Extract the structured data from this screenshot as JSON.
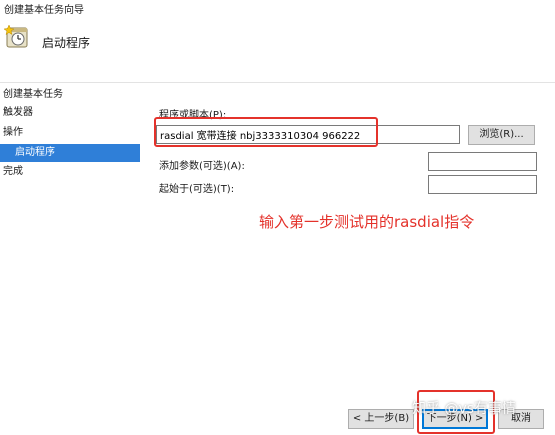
{
  "window": {
    "title": "创建基本任务向导"
  },
  "header": {
    "title": "启动程序",
    "icon": "task-clock-icon"
  },
  "nav": {
    "items": [
      {
        "label": "创建基本任务"
      },
      {
        "label": "触发器"
      },
      {
        "label": "操作"
      },
      {
        "label": "启动程序",
        "selected": true
      },
      {
        "label": "完成"
      }
    ]
  },
  "form": {
    "program_label": "程序或脚本(P):",
    "program_value": "rasdial 宽带连接 nbj3333310304 966222",
    "browse_label": "浏览(R)...",
    "args_label": "添加参数(可选)(A):",
    "args_value": "",
    "start_in_label": "起始于(可选)(T):",
    "start_in_value": ""
  },
  "annotation": {
    "text": "输入第一步测试用的rasdial指令",
    "color": "#e4322b"
  },
  "footer": {
    "back_label": "< 上一步(B)",
    "next_label": "下一步(N) >",
    "cancel_label": "取消"
  },
  "watermark": {
    "text": "知乎 @vs有事情"
  },
  "colors": {
    "accent": "#2f7fd8",
    "highlight": "#e4322b"
  }
}
